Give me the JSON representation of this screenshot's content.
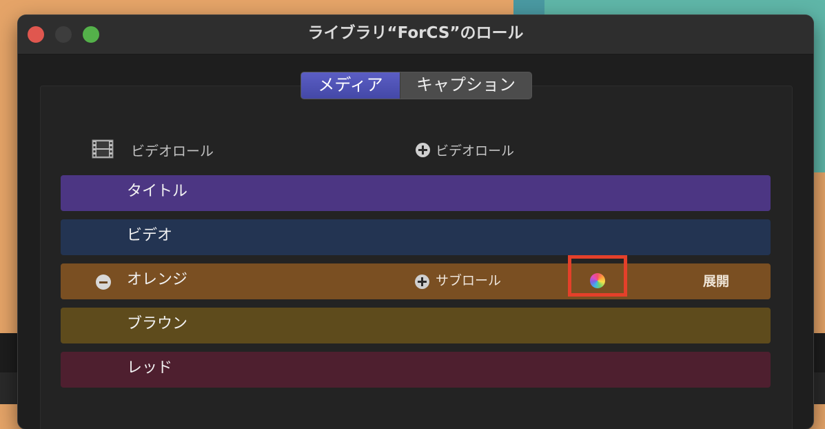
{
  "window": {
    "title": "ライブラリ“ForCS”のロール"
  },
  "tabs": [
    {
      "label": "メディア",
      "selected": true
    },
    {
      "label": "キャプション",
      "selected": false
    }
  ],
  "header": {
    "icon": "film-icon",
    "label": "ビデオロール",
    "add_label": "ビデオロール"
  },
  "roles": [
    {
      "label": "タイトル",
      "color": "#4c3683"
    },
    {
      "label": "ビデオ",
      "color": "#233452"
    },
    {
      "label": "オレンジ",
      "color": "#7a4f22",
      "selected": true,
      "add_sub_label": "サブロール",
      "expand_label": "展開"
    },
    {
      "label": "ブラウン",
      "color": "#5e4b1c"
    },
    {
      "label": "レッド",
      "color": "#4e1f2f"
    }
  ],
  "colors": {
    "accent_tab": "#5054b9",
    "highlight": "#e4402a"
  }
}
